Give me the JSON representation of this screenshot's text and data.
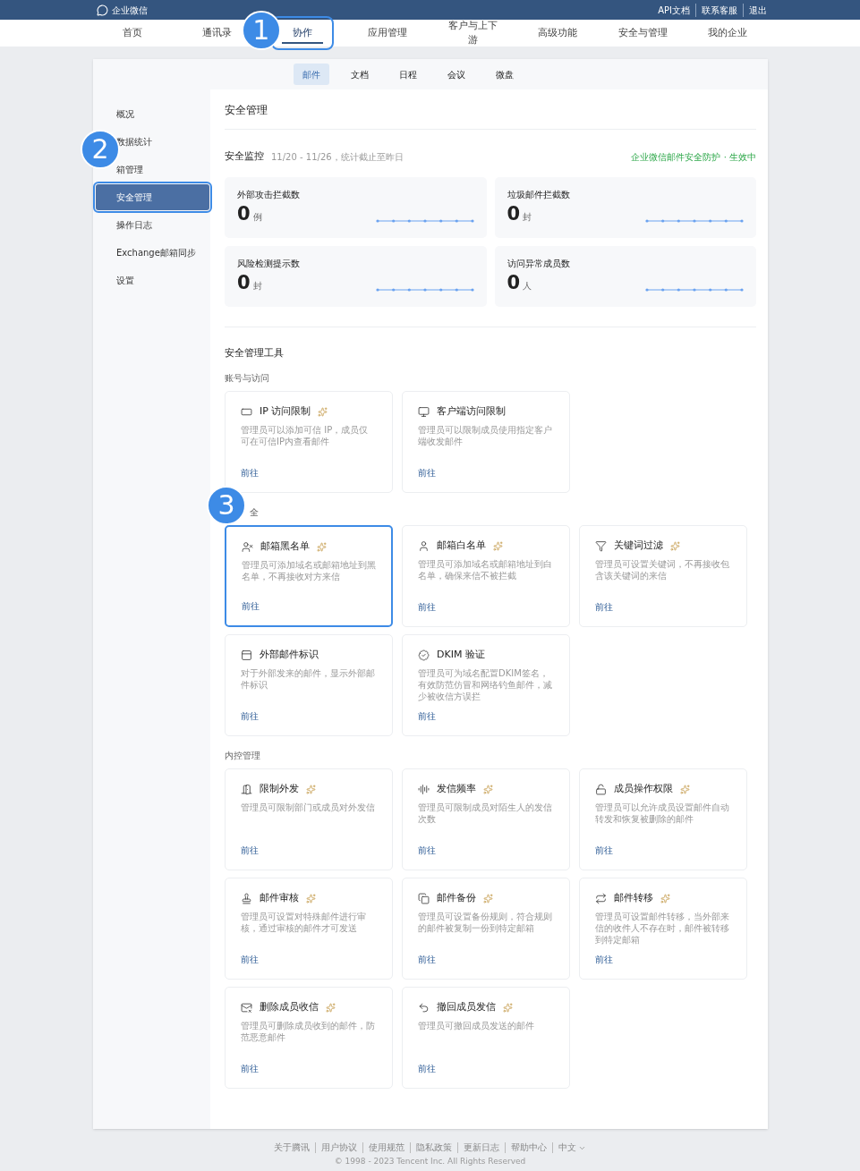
{
  "top_bar": {
    "logo": "企业微信",
    "links": [
      "API文档",
      "联系客服",
      "退出"
    ]
  },
  "nav": [
    {
      "label": "首页",
      "selected": false,
      "highlighted": false
    },
    {
      "label": "通讯录",
      "selected": false,
      "highlighted": false
    },
    {
      "label": "协作",
      "selected": true,
      "highlighted": true,
      "callout": "1"
    },
    {
      "label": "应用管理",
      "selected": false,
      "highlighted": false
    },
    {
      "label": "客户与上下游",
      "selected": false,
      "highlighted": false
    },
    {
      "label": "高级功能",
      "selected": false,
      "highlighted": false
    },
    {
      "label": "安全与管理",
      "selected": false,
      "highlighted": false
    },
    {
      "label": "我的企业",
      "selected": false,
      "highlighted": false
    }
  ],
  "subtabs": [
    {
      "label": "邮件",
      "selected": true
    },
    {
      "label": "文档",
      "selected": false
    },
    {
      "label": "日程",
      "selected": false
    },
    {
      "label": "会议",
      "selected": false
    },
    {
      "label": "微盘",
      "selected": false
    }
  ],
  "sidebar": [
    {
      "label": "概况",
      "selected": false,
      "highlighted": false
    },
    {
      "label": "数据统计",
      "selected": false,
      "highlighted": false
    },
    {
      "label": "箱管理",
      "selected": false,
      "highlighted": false
    },
    {
      "label": "安全管理",
      "selected": true,
      "highlighted": true,
      "callout": "2"
    },
    {
      "label": "操作日志",
      "selected": false,
      "highlighted": false
    },
    {
      "label": "Exchange邮箱同步",
      "selected": false,
      "highlighted": false
    },
    {
      "label": "设置",
      "selected": false,
      "highlighted": false
    }
  ],
  "page_title": "安全管理",
  "monitor": {
    "title": "安全监控",
    "period": "11/20 - 11/26，统计截止至昨日",
    "status": "企业微信邮件安全防护 · 生效中",
    "stats": [
      {
        "label": "外部攻击拦截数",
        "value": "0",
        "unit": "例"
      },
      {
        "label": "垃圾邮件拦截数",
        "value": "0",
        "unit": "封"
      },
      {
        "label": "风险检测提示数",
        "value": "0",
        "unit": "封"
      },
      {
        "label": "访问异常成员数",
        "value": "0",
        "unit": "人"
      }
    ]
  },
  "tools": {
    "title": "安全管理工具",
    "groups": [
      {
        "title": "账号与访问",
        "cards": [
          {
            "title": "IP 访问限制",
            "premium": true,
            "description": "管理员可以添加可信 IP，成员仅可在可信IP内查看邮件",
            "link": "前往",
            "highlighted": false
          },
          {
            "title": "客户端访问限制",
            "premium": false,
            "description": "管理员可以限制成员使用指定客户端收发邮件",
            "link": "前往",
            "highlighted": false
          }
        ]
      },
      {
        "title": "全",
        "cards": [
          {
            "title": "邮箱黑名单",
            "premium": true,
            "description": "管理员可添加域名或邮箱地址到黑名单，不再接收对方来信",
            "link": "前往",
            "highlighted": true,
            "callout": "3"
          },
          {
            "title": "邮箱白名单",
            "premium": true,
            "description": "管理员可添加域名或邮箱地址到白名单，确保来信不被拦截",
            "link": "前往",
            "highlighted": false
          },
          {
            "title": "关键词过滤",
            "premium": true,
            "description": "管理员可设置关键词，不再接收包含该关键词的来信",
            "link": "前往",
            "highlighted": false
          },
          {
            "title": "外部邮件标识",
            "premium": false,
            "description": "对于外部发来的邮件，显示外部邮件标识",
            "link": "前往",
            "highlighted": false
          },
          {
            "title": "DKIM 验证",
            "premium": false,
            "description": "管理员可为域名配置DKIM签名，有效防范仿冒和网络钓鱼邮件，减少被收信方误拦",
            "link": "前往",
            "highlighted": false
          }
        ]
      },
      {
        "title": "内控管理",
        "cards": [
          {
            "title": "限制外发",
            "premium": true,
            "description": "管理员可限制部门或成员对外发信",
            "link": "前往",
            "highlighted": false
          },
          {
            "title": "发信频率",
            "premium": true,
            "description": "管理员可限制成员对陌生人的发信次数",
            "link": "前往",
            "highlighted": false
          },
          {
            "title": "成员操作权限",
            "premium": true,
            "description": "管理员可以允许成员设置邮件自动转发和恢复被删除的邮件",
            "link": "前往",
            "highlighted": false
          },
          {
            "title": "邮件审核",
            "premium": true,
            "description": "管理员可设置对特殊邮件进行审核，通过审核的邮件才可发送",
            "link": "前往",
            "highlighted": false
          },
          {
            "title": "邮件备份",
            "premium": true,
            "description": "管理员可设置备份规则，符合规则的邮件被复制一份到特定邮箱",
            "link": "前往",
            "highlighted": false
          },
          {
            "title": "邮件转移",
            "premium": true,
            "description": "管理员可设置邮件转移，当外部来信的收件人不存在时，邮件被转移到特定邮箱",
            "link": "前往",
            "highlighted": false
          },
          {
            "title": "删除成员收信",
            "premium": true,
            "description": "管理员可删除成员收到的邮件，防范恶意邮件",
            "link": "前往",
            "highlighted": false
          },
          {
            "title": "撤回成员发信",
            "premium": true,
            "description": "管理员可撤回成员发送的邮件",
            "link": "前往",
            "highlighted": false
          }
        ]
      }
    ]
  },
  "footer": {
    "links": [
      "关于腾讯",
      "用户协议",
      "使用规范",
      "隐私政策",
      "更新日志",
      "帮助中心"
    ],
    "language": "中文",
    "copyright": "© 1998 - 2023 Tencent Inc. All Rights Reserved"
  }
}
